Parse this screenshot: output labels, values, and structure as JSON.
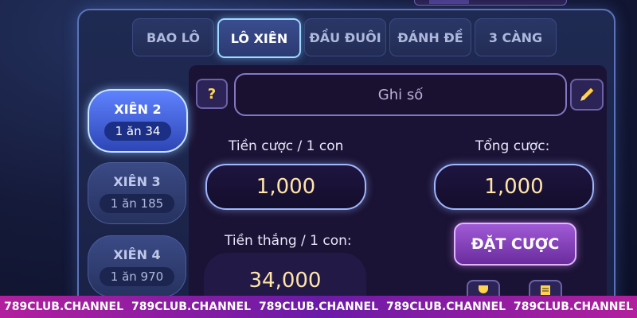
{
  "tabs": [
    {
      "label": "BAO LÔ"
    },
    {
      "label": "LÔ XIÊN"
    },
    {
      "label": "ĐẦU ĐUÔI"
    },
    {
      "label": "ĐÁNH ĐỀ"
    },
    {
      "label": "3 CÀNG"
    }
  ],
  "active_tab": "LÔ XIÊN",
  "side_options": [
    {
      "title": "XIÊN 2",
      "odds": "1 ăn 34"
    },
    {
      "title": "XIÊN 3",
      "odds": "1 ăn 185"
    },
    {
      "title": "XIÊN 4",
      "odds": "1 ăn 970"
    }
  ],
  "help_label": "?",
  "input_placeholder": "Ghi số",
  "bet_per_label": "Tiền cược / 1 con",
  "bet_per_value": "1,000",
  "total_label": "Tổng cược:",
  "total_value": "1,000",
  "win_label": "Tiền thắng / 1 con:",
  "win_value": "34,000",
  "place_bet_label": "ĐẶT CƯỢC",
  "footer_items": [
    "789CLUB.CHANNEL",
    "789CLUB.CHANNEL",
    "789CLUB.CHANNEL",
    "789CLUB.CHANNEL",
    "789CLUB.CHANNEL"
  ],
  "icons": [
    "pencil-icon",
    "trophy-icon",
    "list-icon"
  ]
}
